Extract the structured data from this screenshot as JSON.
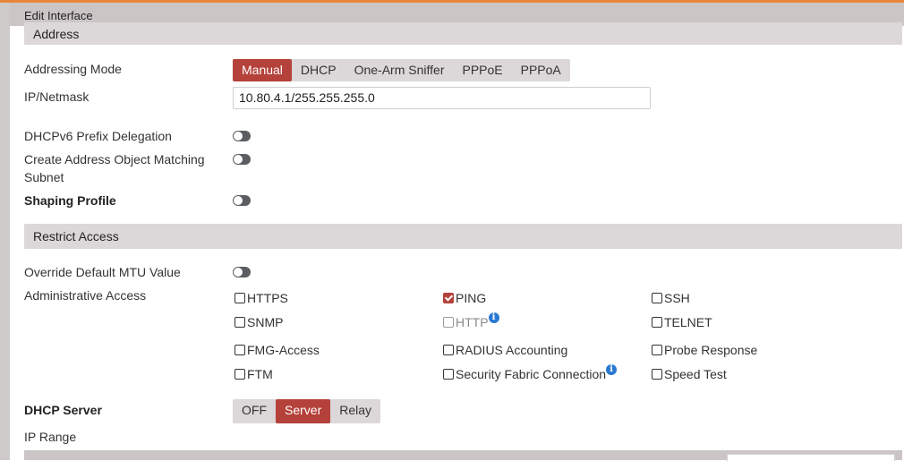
{
  "title": "Edit Interface",
  "sections": {
    "address": "Address",
    "restrict_access": "Restrict Access"
  },
  "address": {
    "addressing_mode_label": "Addressing Mode",
    "addressing_modes": [
      "Manual",
      "DHCP",
      "One-Arm Sniffer",
      "PPPoE",
      "PPPoA"
    ],
    "addressing_mode_selected": "Manual",
    "ip_netmask_label": "IP/Netmask",
    "ip_netmask_value": "10.80.4.1/255.255.255.0",
    "dhcpv6_label": "DHCPv6 Prefix Delegation",
    "create_address_label_line1": "Create Address Object Matching",
    "create_address_label_line2": "Subnet",
    "shaping_profile_label": "Shaping Profile"
  },
  "toggles": {
    "dhcpv6": false,
    "create_address_object": false,
    "shaping_profile": false,
    "override_mtu": false
  },
  "restrict": {
    "override_mtu_label": "Override Default MTU Value",
    "admin_access_label": "Administrative Access",
    "admin_access": {
      "https": {
        "label": "HTTPS",
        "checked": false
      },
      "ping": {
        "label": "PING",
        "checked": true
      },
      "ssh": {
        "label": "SSH",
        "checked": false
      },
      "snmp": {
        "label": "SNMP",
        "checked": false
      },
      "http": {
        "label": "HTTP",
        "checked": false,
        "disabled": true
      },
      "telnet": {
        "label": "TELNET",
        "checked": false
      },
      "fmg_access": {
        "label": "FMG-Access",
        "checked": false
      },
      "radius_accounting": {
        "label": "RADIUS Accounting",
        "checked": false
      },
      "probe_response": {
        "label": "Probe Response",
        "checked": false
      },
      "ftm": {
        "label": "FTM",
        "checked": false
      },
      "security_fabric": {
        "label": "Security Fabric Connection",
        "checked": false
      },
      "speed_test": {
        "label": "Speed Test",
        "checked": false
      }
    },
    "info_glyph": "i"
  },
  "dhcp": {
    "server_label": "DHCP Server",
    "modes": [
      "OFF",
      "Server",
      "Relay"
    ],
    "mode_selected": "Server",
    "ip_range_label": "IP Range"
  },
  "colors": {
    "accent": "#b4413a",
    "top_line": "#e8863a",
    "info_icon": "#2a79d2",
    "toggle_off": "#5a5e63"
  }
}
